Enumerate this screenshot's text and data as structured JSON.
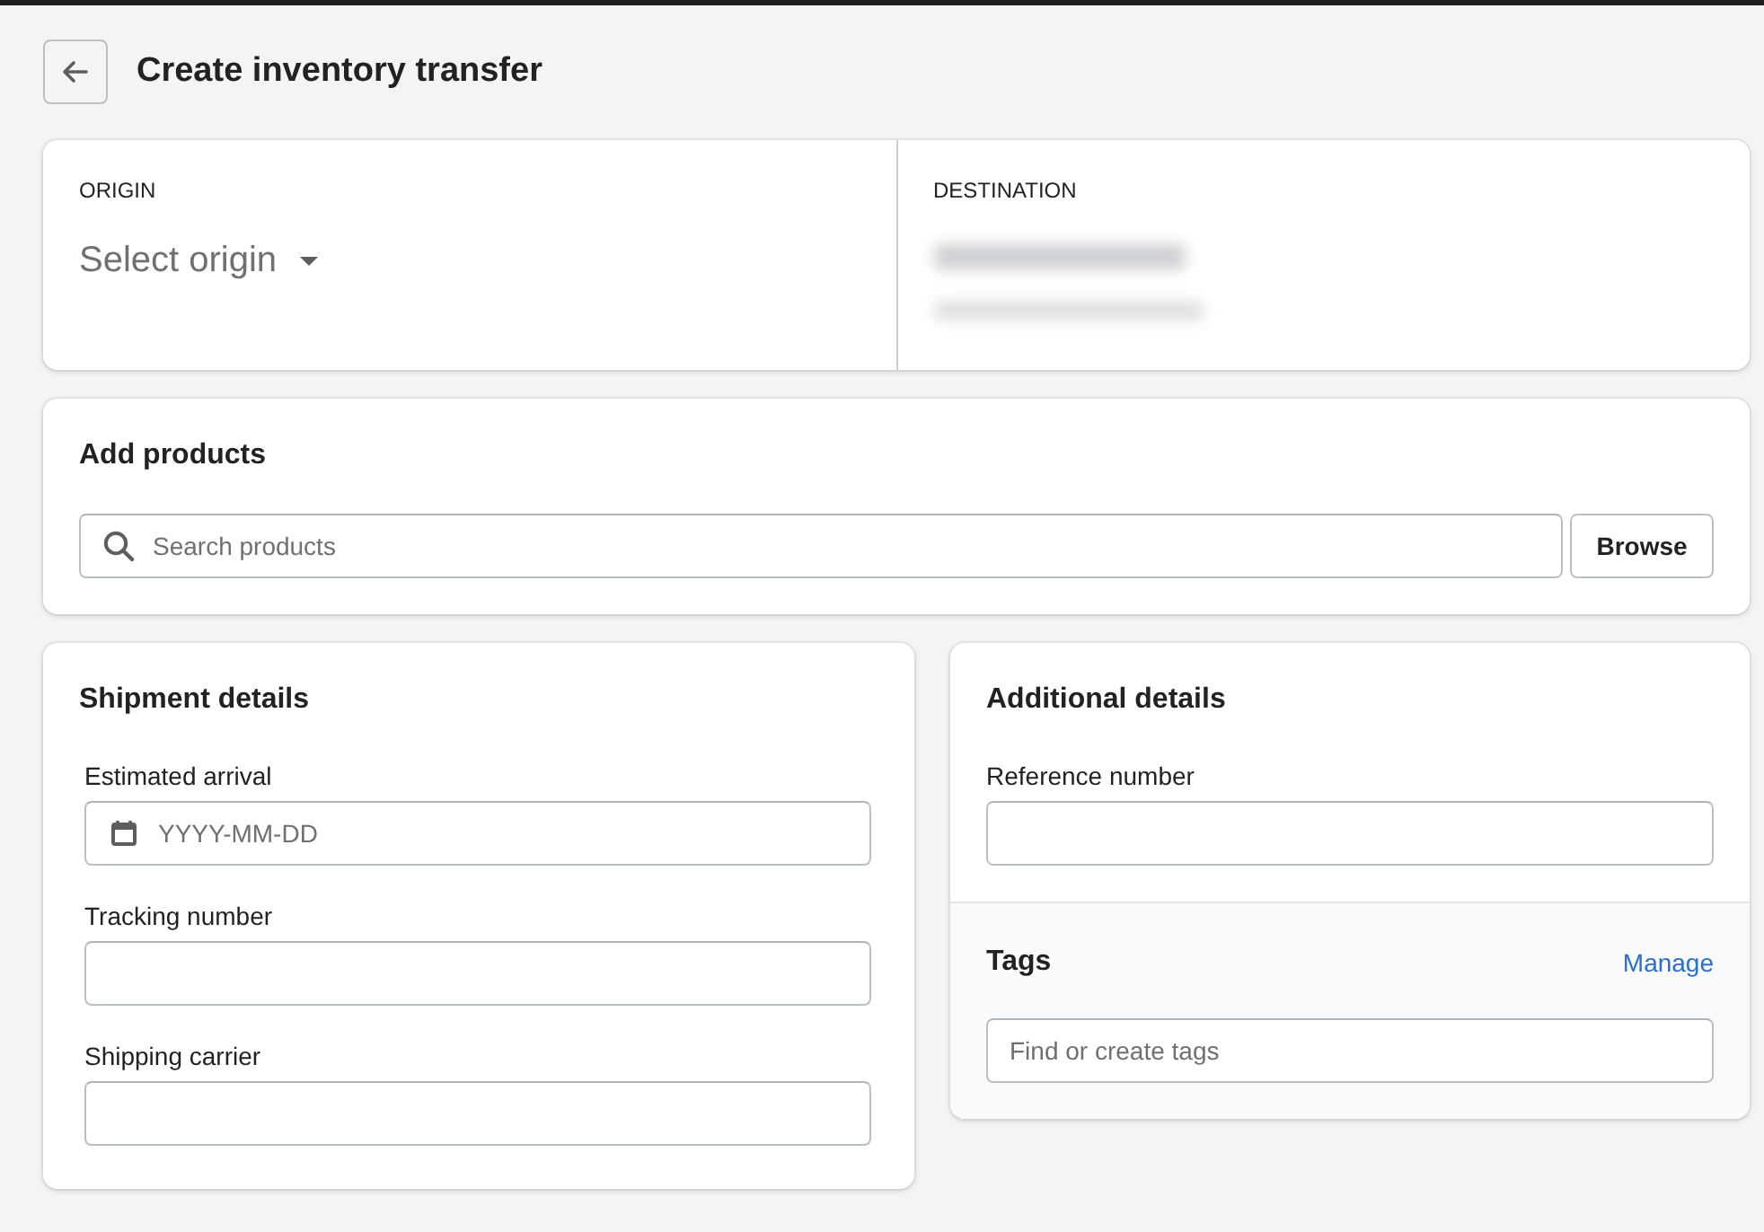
{
  "page": {
    "title": "Create inventory transfer"
  },
  "origin": {
    "label": "ORIGIN",
    "placeholder": "Select origin"
  },
  "destination": {
    "label": "DESTINATION",
    "value_blurred": true
  },
  "add_products": {
    "title": "Add products",
    "search": {
      "placeholder": "Search products"
    },
    "browse_button": "Browse"
  },
  "shipment_details": {
    "title": "Shipment details",
    "fields": [
      {
        "kind": "date",
        "label": "Estimated arrival",
        "placeholder": "YYYY-MM-DD"
      },
      {
        "kind": "text",
        "label": "Tracking number"
      },
      {
        "kind": "text",
        "label": "Shipping carrier"
      }
    ]
  },
  "additional_details": {
    "title": "Additional details",
    "fields": [
      {
        "kind": "text",
        "label": "Reference number"
      }
    ],
    "tags": {
      "title": "Tags",
      "link": "Manage",
      "input": {
        "placeholder": "Find or create tags"
      }
    }
  }
}
